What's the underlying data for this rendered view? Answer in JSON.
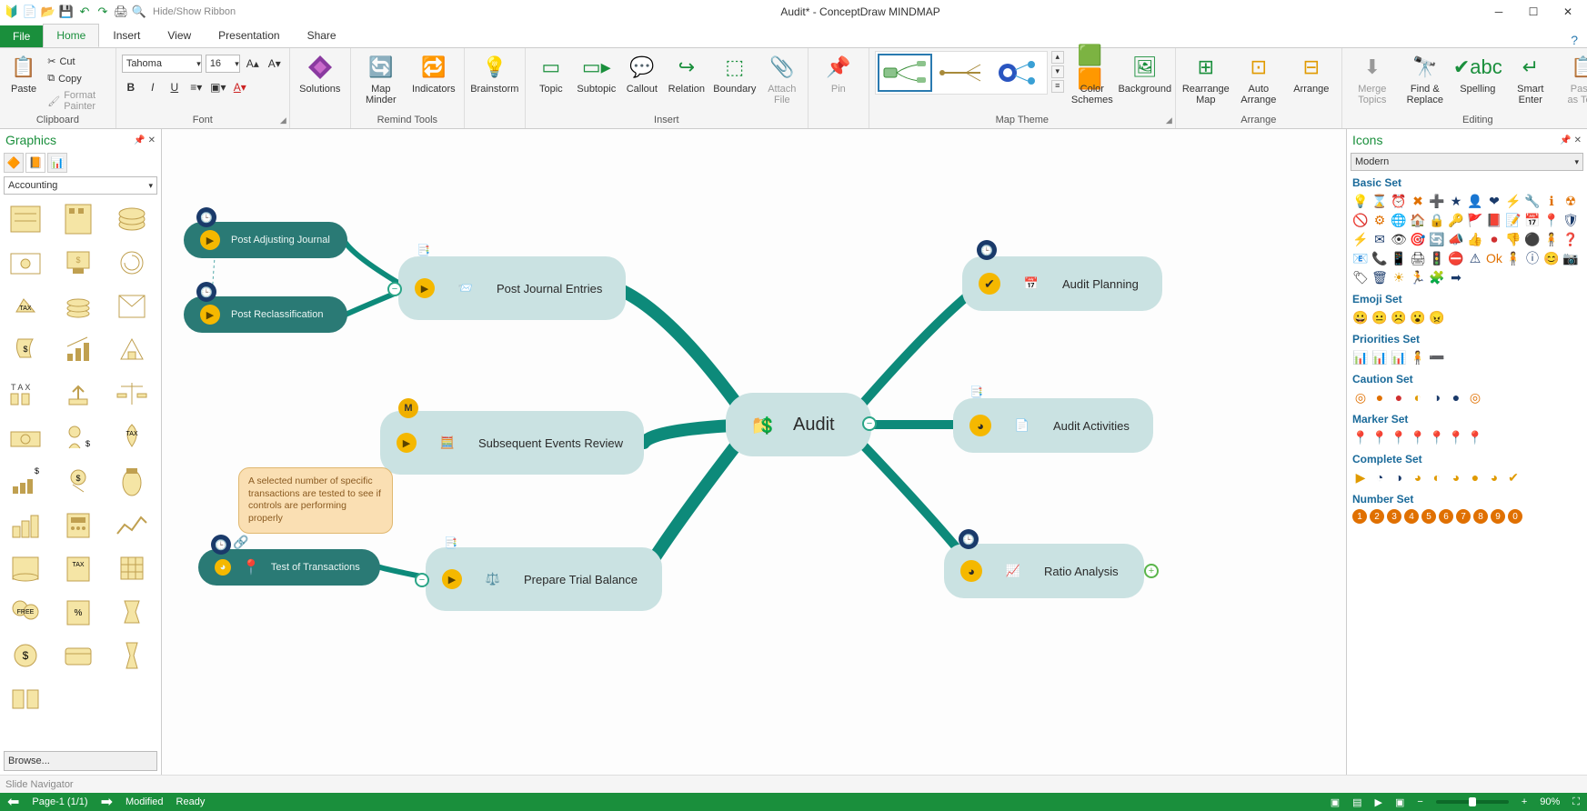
{
  "titlebar": {
    "qat_hideribbon": "Hide/Show Ribbon",
    "title": "Audit* - ConceptDraw MINDMAP"
  },
  "tabs": {
    "file": "File",
    "list": [
      "Home",
      "Insert",
      "View",
      "Presentation",
      "Share"
    ],
    "active": "Home"
  },
  "ribbon": {
    "clipboard": {
      "label": "Clipboard",
      "paste": "Paste",
      "cut": "Cut",
      "copy": "Copy",
      "fmtpainter": "Format Painter"
    },
    "font": {
      "label": "Font",
      "name": "Tahoma",
      "size": "16"
    },
    "solutions": {
      "label": "Solutions"
    },
    "remind": {
      "label": "Remind Tools",
      "mapminder": "Map\nMinder",
      "indicators": "Indicators"
    },
    "brainstorm": "Brainstorm",
    "insert": {
      "label": "Insert",
      "topic": "Topic",
      "subtopic": "Subtopic",
      "callout": "Callout",
      "relation": "Relation",
      "boundary": "Boundary",
      "attach": "Attach\nFile"
    },
    "pin": "Pin",
    "maptheme": {
      "label": "Map Theme",
      "colorschemes": "Color\nSchemes",
      "background": "Background"
    },
    "arrange": {
      "label": "Arrange",
      "rearrange": "Rearrange\nMap",
      "auto": "Auto\nArrange",
      "arrange": "Arrange"
    },
    "editing": {
      "label": "Editing",
      "merge": "Merge\nTopics",
      "findreplace": "Find &\nReplace",
      "spelling": "Spelling",
      "smartenter": "Smart\nEnter",
      "pastetext": "Paste\nas Text"
    }
  },
  "leftpanel": {
    "title": "Graphics",
    "library": "Accounting",
    "browse": "Browse..."
  },
  "mindmap": {
    "central": "Audit",
    "left": {
      "pje": "Post Journal Entries",
      "paj": "Post Adjusting Journal",
      "prc": "Post Reclassification",
      "ser": "Subsequent Events Review",
      "ptb": "Prepare Trial Balance",
      "tot": "Test of Transactions"
    },
    "right": {
      "ap": "Audit Planning",
      "aa": "Audit Activities",
      "ra": "Ratio Analysis"
    },
    "callout": "A selected number of specific transactions are tested to see if controls are performing properly"
  },
  "rightpanel": {
    "title": "Icons",
    "style": "Modern",
    "sets": {
      "basic": "Basic Set",
      "emoji": "Emoji Set",
      "priorities": "Priorities Set",
      "caution": "Caution Set",
      "marker": "Marker Set",
      "complete": "Complete Set",
      "number": "Number Set"
    }
  },
  "status": {
    "slidenav": "Slide Navigator",
    "page": "Page-1 (1/1)",
    "modified": "Modified",
    "ready": "Ready",
    "zoom": "90%"
  }
}
